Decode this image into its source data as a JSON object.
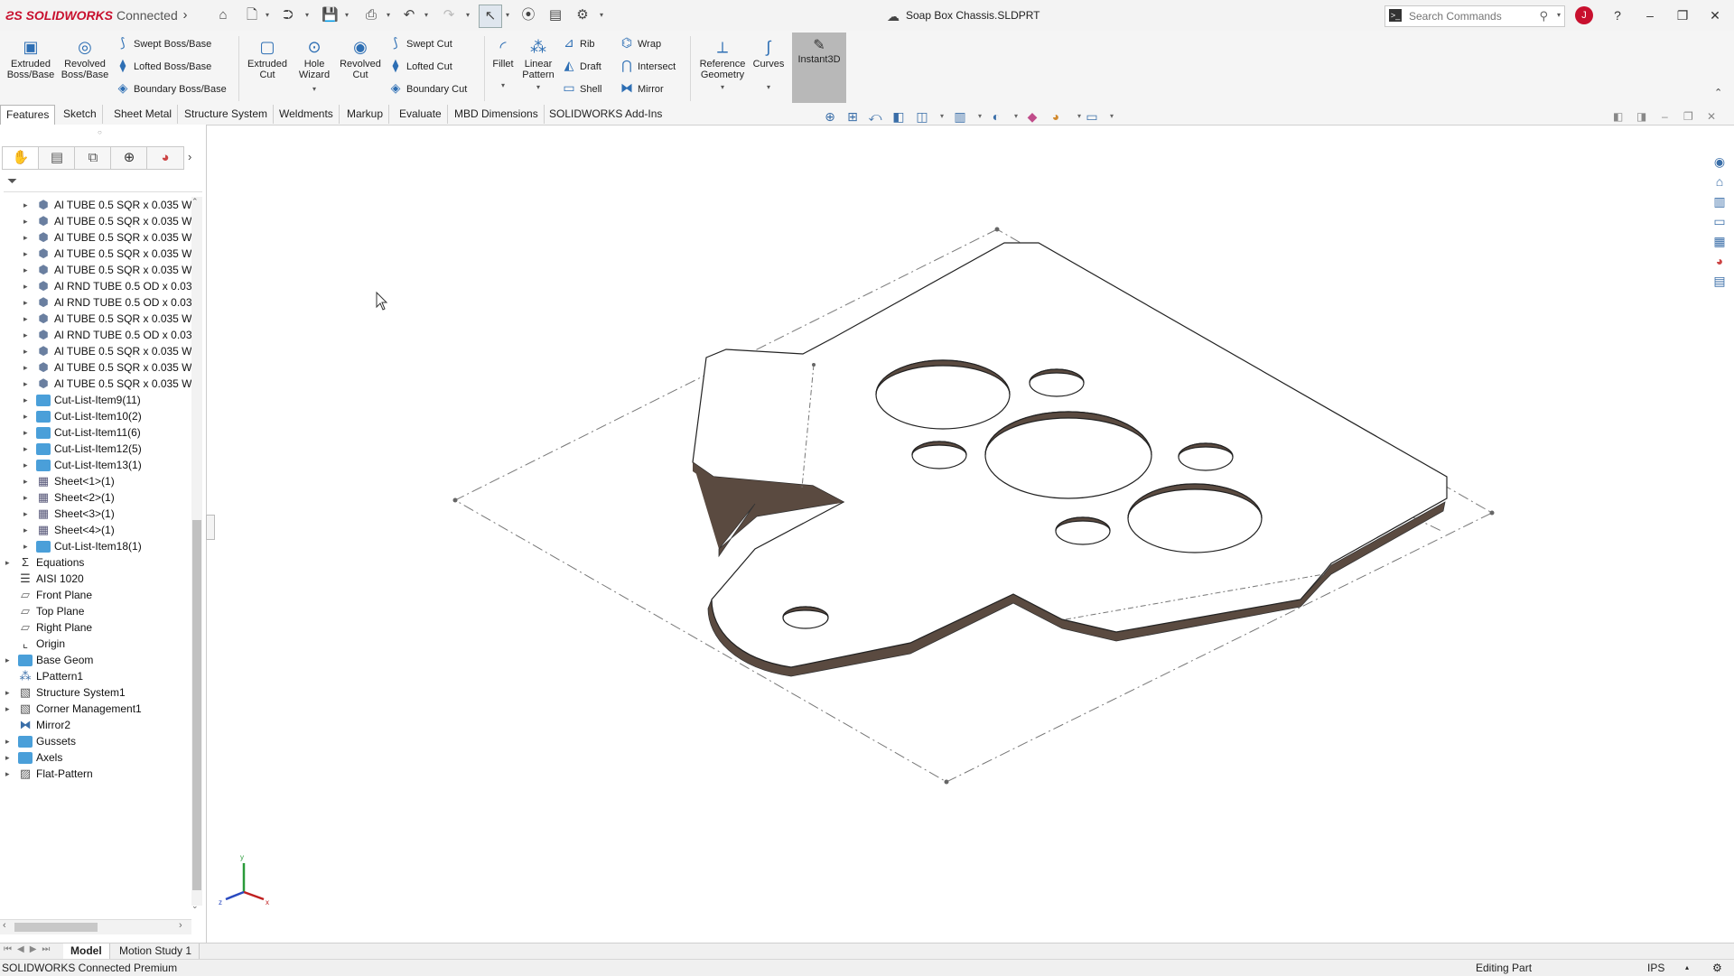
{
  "app": {
    "brand": "SOLIDWORKS",
    "brand_suffix": "Connected",
    "document_title": "Soap Box Chassis.SLDPRT"
  },
  "search": {
    "placeholder": "Search Commands"
  },
  "user": {
    "initial": "J"
  },
  "ribbon": {
    "extruded_boss": "Extruded Boss/Base",
    "revolved_boss": "Revolved Boss/Base",
    "swept_boss": "Swept Boss/Base",
    "lofted_boss": "Lofted Boss/Base",
    "boundary_boss": "Boundary Boss/Base",
    "extruded_cut": "Extruded Cut",
    "hole_wizard": "Hole Wizard",
    "revolved_cut": "Revolved Cut",
    "swept_cut": "Swept Cut",
    "lofted_cut": "Lofted Cut",
    "boundary_cut": "Boundary Cut",
    "fillet": "Fillet",
    "linear_pattern": "Linear Pattern",
    "rib": "Rib",
    "draft": "Draft",
    "shell": "Shell",
    "wrap": "Wrap",
    "intersect": "Intersect",
    "mirror": "Mirror",
    "reference_geometry": "Reference Geometry",
    "curves": "Curves",
    "instant3d": "Instant3D"
  },
  "tabs": [
    "Features",
    "Sketch",
    "Sheet Metal",
    "Structure System",
    "Weldments",
    "Markup",
    "Evaluate",
    "MBD Dimensions",
    "SOLIDWORKS Add-Ins"
  ],
  "tree": [
    {
      "label": "Al TUBE 0.5 SQR x 0.035 W",
      "type": "weld",
      "indent": 1
    },
    {
      "label": "Al TUBE 0.5 SQR x 0.035 W",
      "type": "weld",
      "indent": 1
    },
    {
      "label": "Al TUBE 0.5 SQR x 0.035 W",
      "type": "weld",
      "indent": 1
    },
    {
      "label": "Al TUBE 0.5 SQR x 0.035 W",
      "type": "weld",
      "indent": 1
    },
    {
      "label": "Al TUBE 0.5 SQR x 0.035 W",
      "type": "weld",
      "indent": 1
    },
    {
      "label": "Al RND TUBE 0.5 OD x 0.03",
      "type": "weld",
      "indent": 1
    },
    {
      "label": "Al RND TUBE 0.5 OD x 0.03",
      "type": "weld",
      "indent": 1
    },
    {
      "label": "Al TUBE 0.5 SQR x 0.035 W",
      "type": "weld",
      "indent": 1
    },
    {
      "label": "Al RND TUBE 0.5 OD x 0.03",
      "type": "weld",
      "indent": 1
    },
    {
      "label": "Al TUBE 0.5 SQR x 0.035 W",
      "type": "weld",
      "indent": 1
    },
    {
      "label": "Al TUBE 0.5 SQR x 0.035 W",
      "type": "weld",
      "indent": 1
    },
    {
      "label": "Al TUBE 0.5 SQR x 0.035 W",
      "type": "weld",
      "indent": 1
    },
    {
      "label": "Cut-List-Item9(11)",
      "type": "folder",
      "indent": 1
    },
    {
      "label": "Cut-List-Item10(2)",
      "type": "folder",
      "indent": 1
    },
    {
      "label": "Cut-List-Item11(6)",
      "type": "folder",
      "indent": 1
    },
    {
      "label": "Cut-List-Item12(5)",
      "type": "folder",
      "indent": 1
    },
    {
      "label": "Cut-List-Item13(1)",
      "type": "folder",
      "indent": 1
    },
    {
      "label": "Sheet<1>(1)",
      "type": "sheet",
      "indent": 1
    },
    {
      "label": "Sheet<2>(1)",
      "type": "sheet",
      "indent": 1
    },
    {
      "label": "Sheet<3>(1)",
      "type": "sheet",
      "indent": 1
    },
    {
      "label": "Sheet<4>(1)",
      "type": "sheet",
      "indent": 1
    },
    {
      "label": "Cut-List-Item18(1)",
      "type": "folder",
      "indent": 1
    },
    {
      "label": "Equations",
      "type": "equations",
      "indent": 0,
      "expand": true
    },
    {
      "label": "AISI 1020",
      "type": "material",
      "indent": 0,
      "expand": false
    },
    {
      "label": "Front Plane",
      "type": "plane",
      "indent": 0,
      "expand": false
    },
    {
      "label": "Top Plane",
      "type": "plane",
      "indent": 0,
      "expand": false
    },
    {
      "label": "Right Plane",
      "type": "plane",
      "indent": 0,
      "expand": false
    },
    {
      "label": "Origin",
      "type": "origin",
      "indent": 0,
      "expand": false
    },
    {
      "label": "Base Geom",
      "type": "folder",
      "indent": 0,
      "expand": true
    },
    {
      "label": "LPattern1",
      "type": "pattern",
      "indent": 0,
      "expand": false
    },
    {
      "label": "Structure System1",
      "type": "structure",
      "indent": 0,
      "expand": true
    },
    {
      "label": "Corner Management1",
      "type": "structure",
      "indent": 0,
      "expand": true
    },
    {
      "label": "Mirror2",
      "type": "mirror",
      "indent": 0,
      "expand": false
    },
    {
      "label": "Gussets",
      "type": "folder",
      "indent": 0,
      "expand": true
    },
    {
      "label": "Axels",
      "type": "folder",
      "indent": 0,
      "expand": true
    },
    {
      "label": "Flat-Pattern",
      "type": "flat",
      "indent": 0,
      "expand": true
    }
  ],
  "bottom_tabs": [
    "Model",
    "Motion Study 1"
  ],
  "status": {
    "product": "SOLIDWORKS Connected Premium",
    "mode": "Editing Part",
    "units": "IPS"
  },
  "triad": {
    "x": "x",
    "y": "y",
    "z": "z"
  },
  "colors": {
    "brand": "#c8102e",
    "accent": "#2e6fb4",
    "folder": "#4a9fd9",
    "plate_edge": "#5a4a40"
  }
}
